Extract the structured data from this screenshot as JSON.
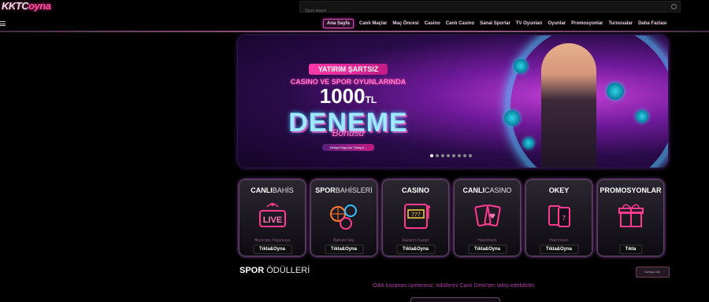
{
  "header": {
    "logo_part1": "KKTC",
    "logo_part2": "oyna",
    "search_placeholder": "Oyun arayın"
  },
  "nav": {
    "items": [
      "Ana Sayfa",
      "Canlı Maçlar",
      "Maç Öncesi",
      "Casino",
      "Canlı Casino",
      "Sanal Sporlar",
      "TV Oyunları",
      "Oyunlar",
      "Promosyonlar",
      "Turnuvalar",
      "Daha Fazlası"
    ],
    "active_index": 0
  },
  "banner": {
    "pill": "YATIRIM ŞARTSIZ",
    "line": "CASINO VE SPOR OYUNLARINDA",
    "amount": "1000",
    "currency": "TL",
    "title": "DENEME",
    "subtitle": "Bonusu",
    "detail_button": "Detaylı Bilgi İçin Tıklayın...",
    "slide_count": 8,
    "active_slide": 0
  },
  "cards": [
    {
      "title_a": "CANLI",
      "title_b": "BAHİS",
      "icon": "live-tv-icon",
      "sub": "Heyecanı Yaşamaya",
      "button": "Tıkla&Oyna"
    },
    {
      "title_a": "SPOR",
      "title_b": "BAHİSLERİ",
      "icon": "sports-balls-icon",
      "sub": "Bahsini Seç",
      "button": "Tıkla&Oyna"
    },
    {
      "title_a": "CASINO",
      "title_b": "",
      "icon": "slot-machine-icon",
      "sub": "Kazancı Kazan",
      "button": "Tıkla&Oyna"
    },
    {
      "title_a": "CANLI",
      "title_b": "CASINO",
      "icon": "playing-cards-icon",
      "sub": "Hazırmısın",
      "button": "Tıkla&Oyna"
    },
    {
      "title_a": "OKEY",
      "title_b": "",
      "icon": "okey-tiles-icon",
      "sub": "Hazırmısın",
      "button": "Tıkla&Oyna"
    },
    {
      "title_a": "PROMOSYONLAR",
      "title_b": "",
      "icon": "gift-icon",
      "sub": "",
      "button": "Tıkla"
    }
  ],
  "spor_section": {
    "title_a": "SPOR",
    "title_b": "ÖDÜLLERİ",
    "button": "Detaylı Gör",
    "text": "Ödül kazanan üyelerimiz, ödüllerini Canlı Desk'ten talep edebilirler."
  },
  "colors": {
    "accent": "#d04fb0",
    "neon_pink": "#ff2da0",
    "neon_cyan": "#35c0ff",
    "background": "#000000"
  }
}
